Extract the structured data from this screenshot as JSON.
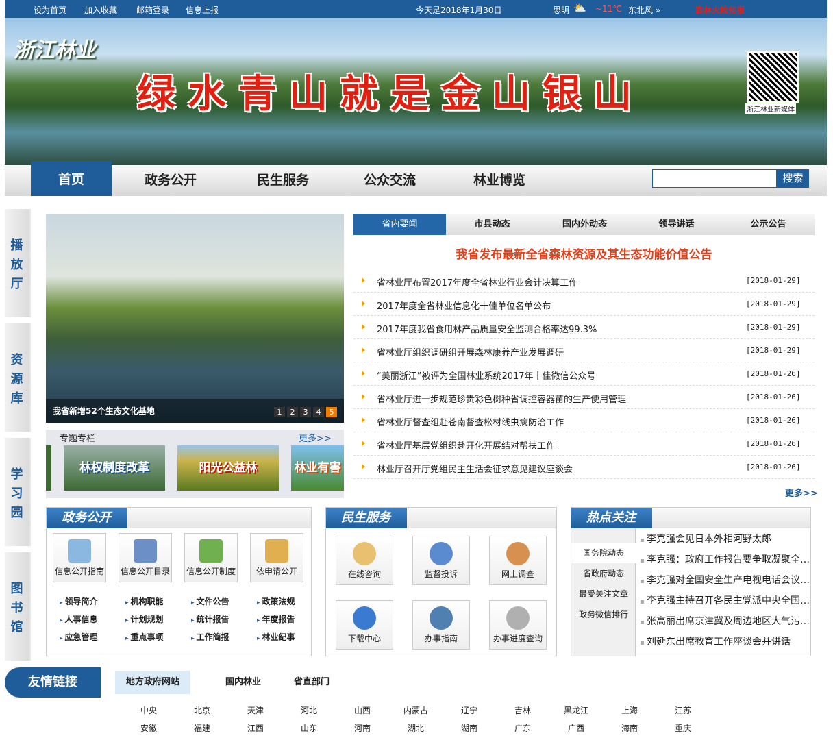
{
  "topbar": {
    "links": [
      "设为首页",
      "加入收藏",
      "邮箱登录",
      "信息上报"
    ],
    "date": "今天是2018年1月30日",
    "city": "思明",
    "temp": "~11℃",
    "wind": "东北风 »",
    "alert": "森林火险预报",
    "weather_icon": "cloud-sun-icon"
  },
  "banner": {
    "logo": "浙江林业",
    "slogan": "绿水青山就是金山银山",
    "qr_label": "浙江林业新媒体"
  },
  "nav": {
    "items": [
      "首页",
      "政务公开",
      "民生服务",
      "公众交流",
      "林业博览"
    ],
    "search_placeholder": "",
    "search_button": "搜索"
  },
  "side_tabs": [
    "播放厅",
    "资源库",
    "学习园",
    "图书馆"
  ],
  "slideshow": {
    "caption": "我省新增52个生态文化基地",
    "pages": [
      "1",
      "2",
      "3",
      "4",
      "5"
    ],
    "current": 5
  },
  "topics": {
    "title": "专题专栏",
    "more": "更多>>",
    "items": [
      "林权制度改革",
      "阳光公益林",
      "林业有害"
    ]
  },
  "news": {
    "tabs": [
      "省内要闻",
      "市县动态",
      "国内外动态",
      "领导讲话",
      "公示公告"
    ],
    "headline": "我省发布最新全省森林资源及其生态功能价值公告",
    "more": "更多>>",
    "items": [
      {
        "title": "省林业厅布置2017年度全省林业行业会计决算工作",
        "date": "[2018-01-29]"
      },
      {
        "title": "2017年度全省林业信息化十佳单位名单公布",
        "date": "[2018-01-29]"
      },
      {
        "title": "2017年度我省食用林产品质量安全监测合格率达99.3%",
        "date": "[2018-01-29]"
      },
      {
        "title": "省林业厅组织调研组开展森林康养产业发展调研",
        "date": "[2018-01-29]"
      },
      {
        "title": "“美丽浙江”被评为全国林业系统2017年十佳微信公众号",
        "date": "[2018-01-26]"
      },
      {
        "title": "省林业厅进一步规范珍贵彩色树种省调控容器苗的生产使用管理",
        "date": "[2018-01-26]"
      },
      {
        "title": "省林业厅督查组赴苍南督查松材线虫病防治工作",
        "date": "[2018-01-26]"
      },
      {
        "title": "省林业厅基层党组织赴开化开展结对帮扶工作",
        "date": "[2018-01-26]"
      },
      {
        "title": "林业厅召开厅党组民主生活会征求意见建议座谈会",
        "date": "[2018-01-26]"
      }
    ]
  },
  "gov": {
    "title": "政务公开",
    "buttons": [
      "信息公开指南",
      "信息公开目录",
      "信息公开制度",
      "依申请公开"
    ],
    "links": [
      "领导简介",
      "机构职能",
      "文件公告",
      "政策法规",
      "人事信息",
      "计划规划",
      "统计报告",
      "年度报告",
      "应急管理",
      "重点事项",
      "工作简报",
      "林业纪事"
    ]
  },
  "service": {
    "title": "民生服务",
    "buttons": [
      "在线咨询",
      "监督投诉",
      "网上调查",
      "下载中心",
      "办事指南",
      "办事进度查询"
    ]
  },
  "hot": {
    "title": "热点关注",
    "tabs": [
      "国务院动态",
      "省政府动态",
      "最受关注文章",
      "政务微信排行"
    ],
    "items": [
      "李克强会见日本外相河野太郎",
      "李克强：政府工作报告要争取凝聚全社会共识",
      "李克强对全国安全生产电视电话会议作出批示",
      "李克强主持召开各民主党派中央全国工商联座谈会",
      "张高丽出席京津冀及周边地区大气污染防治会议",
      "刘延东出席教育工作座谈会并讲话"
    ]
  },
  "links": {
    "title": "友情链接",
    "tabs": [
      "地方政府网站",
      "国内林业",
      "省直部门"
    ],
    "cities": [
      "中央",
      "北京",
      "天津",
      "河北",
      "山西",
      "内蒙古",
      "辽宁",
      "吉林",
      "黑龙江",
      "上海",
      "江苏",
      "安徽",
      "福建",
      "江西",
      "山东",
      "河南",
      "湖北",
      "湖南",
      "广东",
      "广西",
      "海南",
      "重庆"
    ]
  },
  "colors": {
    "primary": "#1f5d9a",
    "accent": "#e0401a",
    "highlight": "#f07d00"
  }
}
